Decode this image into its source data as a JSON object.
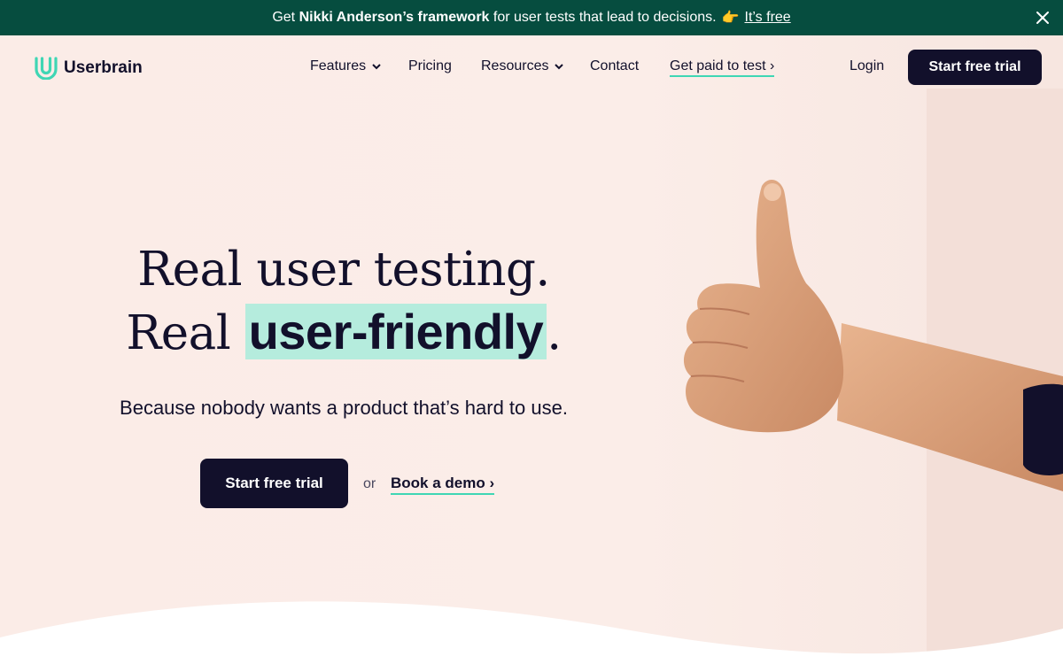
{
  "banner": {
    "prefix": "Get",
    "bold_text": "Nikki Anderson’s framework",
    "suffix": "for user tests that lead to decisions.",
    "emoji": "👉",
    "link": "It’s free",
    "close_icon": "close-icon"
  },
  "nav": {
    "logo_text": "Userbrain",
    "logo_icon": "userbrain-logo-icon",
    "items": [
      {
        "label": "Features",
        "has_dropdown": true
      },
      {
        "label": "Pricing",
        "has_dropdown": false
      },
      {
        "label": "Resources",
        "has_dropdown": true
      },
      {
        "label": "Contact",
        "has_dropdown": false
      },
      {
        "label": "Get paid to test ›",
        "has_dropdown": false
      }
    ],
    "login": "Login",
    "cta": "Start free trial"
  },
  "hero": {
    "line1": "Real user testing.",
    "line2_prefix": "Real",
    "line2_highlight": "user-friendly",
    "line2_suffix": ".",
    "subheadline": "Because nobody wants a product that’s hard to use.",
    "cta": "Start free trial",
    "or": "or",
    "demo_link": "Book a demo ›"
  },
  "colors": {
    "banner_bg": "#064d3f",
    "dark": "#12102b",
    "accent": "#3fd6b4",
    "highlight": "#b5ecdd",
    "hero_bg": "#fbece7"
  }
}
